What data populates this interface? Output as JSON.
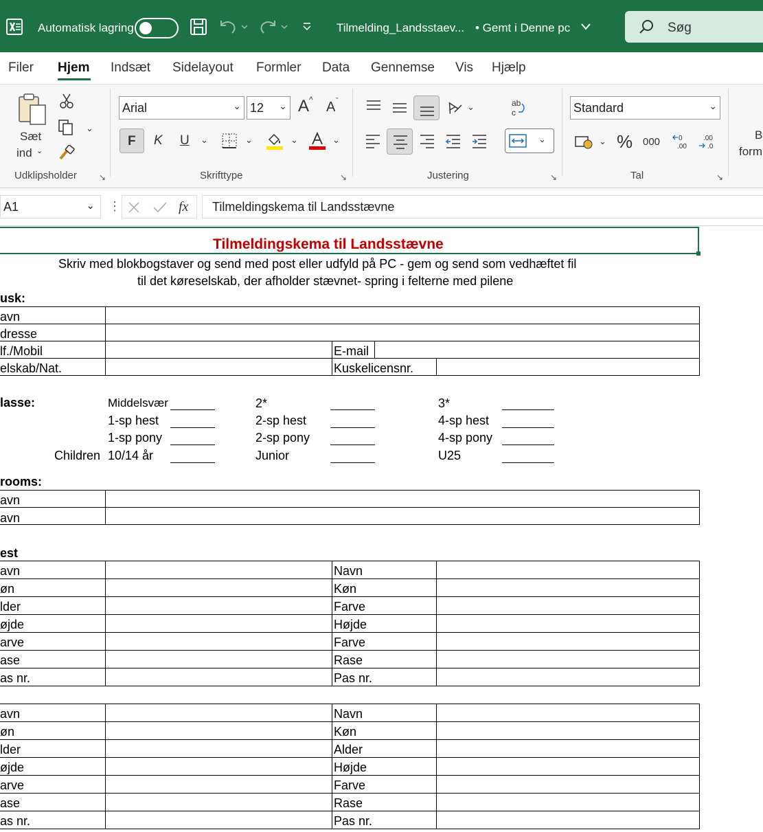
{
  "titlebar": {
    "autosave_label": "Automatisk lagring",
    "filename": "Tilmelding_Landsstaev...",
    "saved_status": "• Gemt i Denne pc",
    "search_label": "Søg"
  },
  "menu": [
    "Filer",
    "Hjem",
    "Indsæt",
    "Sidelayout",
    "Formler",
    "Data",
    "Gennemse",
    "Vis",
    "Hjælp"
  ],
  "ribbon": {
    "clipboard": {
      "paste_line1": "Sæt",
      "paste_line2": "ind",
      "label": "Udklipsholder"
    },
    "font": {
      "name": "Arial",
      "size": "12",
      "grow": "A",
      "shrink": "A",
      "bold": "F",
      "italic": "K",
      "underline": "U",
      "label": "Skrifttype"
    },
    "alignment": {
      "label": "Justering"
    },
    "number": {
      "format": "Standard",
      "percent": "%",
      "thousands": "000",
      "label": "Tal"
    },
    "cutoff": {
      "line1": "Be",
      "line2": "form"
    }
  },
  "formula_bar": {
    "name_box": "A1",
    "fx": "fx",
    "content": "Tilmeldingskema til Landsstævne"
  },
  "sheet": {
    "title": "Tilmeldingskema til Landsstævne",
    "subtitle1": "Skriv med blokbogstaver og send med post eller udfyld på PC - gem og send som vedhæftet fil",
    "subtitle2": "til det køreselskab, der afholder stævnet- spring i felterne med pilene",
    "kusk_header": "usk:",
    "kusk_rows": [
      "avn",
      "dresse",
      "lf./Mobil",
      "elskab/Nat."
    ],
    "email_label": "E-mail",
    "license_label": "Kuskelicensnr.",
    "klasse_header": "lasse:",
    "class_col1": [
      "Middelsvær",
      "1-sp hest",
      "1-sp pony",
      "10/14 år"
    ],
    "children_label": "Children",
    "class_col2": [
      "2*",
      "2-sp hest",
      "2-sp pony",
      "Junior"
    ],
    "class_col3": [
      "3*",
      "4-sp hest",
      "4-sp pony",
      "U25"
    ],
    "grooms_header": "rooms:",
    "groom_rows": [
      "avn",
      "avn"
    ],
    "hest_header": "est",
    "horse1_left": [
      "avn",
      "øn",
      "lder",
      "øjde",
      "arve",
      "ase",
      "as nr."
    ],
    "horse1_right": [
      "Navn",
      "Køn",
      "Farve",
      "Højde",
      "Farve",
      "Rase",
      "Pas nr."
    ],
    "horse2_left": [
      "avn",
      "øn",
      "lder",
      "øjde",
      "arve",
      "ase",
      "as nr."
    ],
    "horse2_right": [
      "Navn",
      "Køn",
      "Alder",
      "Højde",
      "Farve",
      "Rase",
      "Pas nr."
    ]
  },
  "colors": {
    "excel_green": "#1e7145",
    "title_red": "#c00000",
    "search_bg": "#d6ebdf",
    "highlight_yellow": "#ffe600",
    "font_red": "#e00000"
  }
}
